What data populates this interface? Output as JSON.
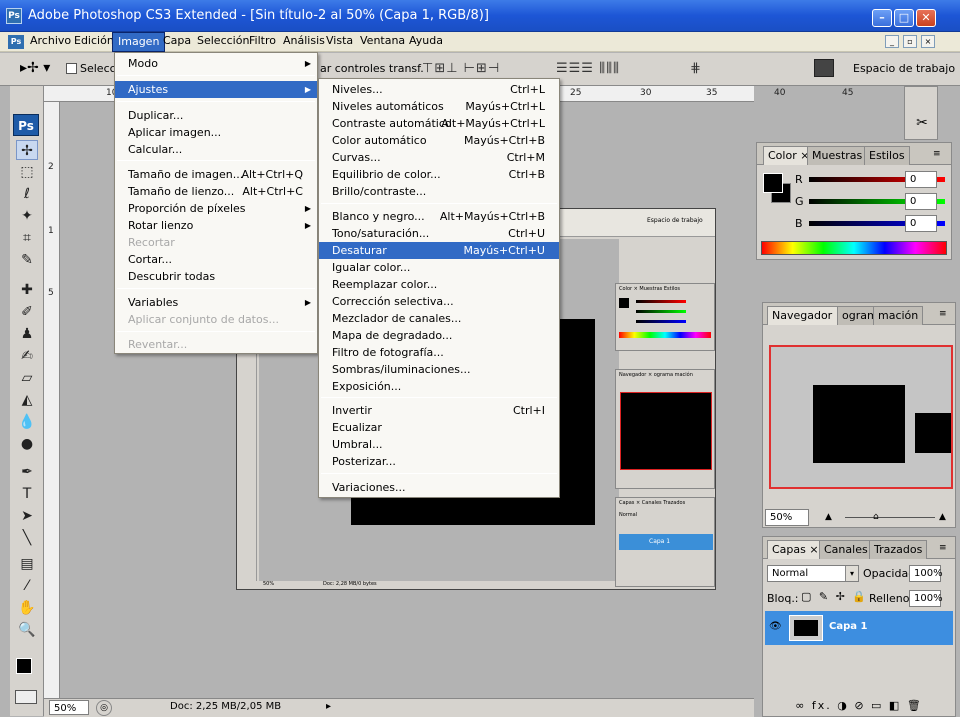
{
  "window": {
    "title": "Adobe Photoshop CS3 Extended - [Sin título-2 al 50% (Capa 1, RGB/8)]",
    "app_icon": "Ps"
  },
  "menubar": {
    "items": [
      "Archivo",
      "Edición",
      "Imagen",
      "Capa",
      "Selección",
      "Filtro",
      "Análisis",
      "Vista",
      "Ventana",
      "Ayuda"
    ]
  },
  "options_bar": {
    "partial_label_left": "Seleccio",
    "partial_label_right": "ar controles transf.",
    "workspace_label": "Espacio de trabajo"
  },
  "rulers": {
    "top_left": "10",
    "top_ticks": [
      "25",
      "30",
      "35",
      "40",
      "45"
    ],
    "side_ticks": [
      "2",
      "1",
      "5"
    ]
  },
  "status_bar": {
    "zoom": "50%",
    "doc": "Doc: 2,25 MB/2,05 MB"
  },
  "imagen_menu": {
    "items": [
      {
        "label": "Modo",
        "submenu": true
      },
      {
        "label": "Ajustes",
        "submenu": true,
        "selected": true
      },
      {
        "label": "Duplicar..."
      },
      {
        "label": "Aplicar imagen..."
      },
      {
        "label": "Calcular..."
      },
      {
        "label": "Tamaño de imagen...",
        "shortcut": "Alt+Ctrl+Q"
      },
      {
        "label": "Tamaño de lienzo...",
        "shortcut": "Alt+Ctrl+C"
      },
      {
        "label": "Proporción de píxeles",
        "submenu": true
      },
      {
        "label": "Rotar lienzo",
        "submenu": true
      },
      {
        "label": "Recortar",
        "disabled": true
      },
      {
        "label": "Cortar..."
      },
      {
        "label": "Descubrir todas"
      },
      {
        "label": "Variables",
        "submenu": true
      },
      {
        "label": "Aplicar conjunto de datos...",
        "disabled": true
      },
      {
        "label": "Reventar...",
        "disabled": true
      }
    ]
  },
  "ajustes_menu": {
    "items": [
      {
        "label": "Niveles...",
        "shortcut": "Ctrl+L"
      },
      {
        "label": "Niveles automáticos",
        "shortcut": "Mayús+Ctrl+L"
      },
      {
        "label": "Contraste automático",
        "shortcut": "Alt+Mayús+Ctrl+L"
      },
      {
        "label": "Color automático",
        "shortcut": "Mayús+Ctrl+B"
      },
      {
        "label": "Curvas...",
        "shortcut": "Ctrl+M"
      },
      {
        "label": "Equilibrio de color...",
        "shortcut": "Ctrl+B"
      },
      {
        "label": "Brillo/contraste..."
      },
      {
        "label": "Blanco y negro...",
        "shortcut": "Alt+Mayús+Ctrl+B"
      },
      {
        "label": "Tono/saturación...",
        "shortcut": "Ctrl+U"
      },
      {
        "label": "Desaturar",
        "shortcut": "Mayús+Ctrl+U",
        "selected": true
      },
      {
        "label": "Igualar color..."
      },
      {
        "label": "Reemplazar color..."
      },
      {
        "label": "Corrección selectiva..."
      },
      {
        "label": "Mezclador de canales..."
      },
      {
        "label": "Mapa de degradado..."
      },
      {
        "label": "Filtro de fotografía..."
      },
      {
        "label": "Sombras/iluminaciones..."
      },
      {
        "label": "Exposición..."
      },
      {
        "label": "Invertir",
        "shortcut": "Ctrl+I"
      },
      {
        "label": "Ecualizar"
      },
      {
        "label": "Umbral..."
      },
      {
        "label": "Posterizar..."
      },
      {
        "label": "Variaciones..."
      }
    ]
  },
  "color_panel": {
    "tabs": [
      "Color ×",
      "Muestras",
      "Estilos"
    ],
    "channels": [
      {
        "label": "R",
        "value": "0"
      },
      {
        "label": "G",
        "value": "0"
      },
      {
        "label": "B",
        "value": "0"
      }
    ]
  },
  "navigator_panel": {
    "tabs": [
      "Navegador ×",
      "ograma",
      "mación"
    ],
    "zoom": "50%"
  },
  "layers_panel": {
    "tabs": [
      "Capas ×",
      "Canales",
      "Trazados"
    ],
    "blend_mode": "Normal",
    "opacity_label": "Opacidad:",
    "opacity": "100%",
    "lock_label": "Bloq.:",
    "fill_label": "Relleno:",
    "fill": "100%",
    "layer_name": "Capa 1",
    "footer_icons": "∞ fx. ◑ ⊘ ▭ ◧ 🗑"
  },
  "inner_shot": {
    "workspace_label": "Espacio de trabajo",
    "color_tabs": "Color × Muestras Estilos",
    "nav_tabs": "Navegador × ograma mación",
    "layers_tabs": "Capas × Canales Trazados",
    "blend": "Normal",
    "layer": "Capa 1",
    "status": "Doc: 2,28 MB/0 bytes",
    "zoom": "50%"
  }
}
